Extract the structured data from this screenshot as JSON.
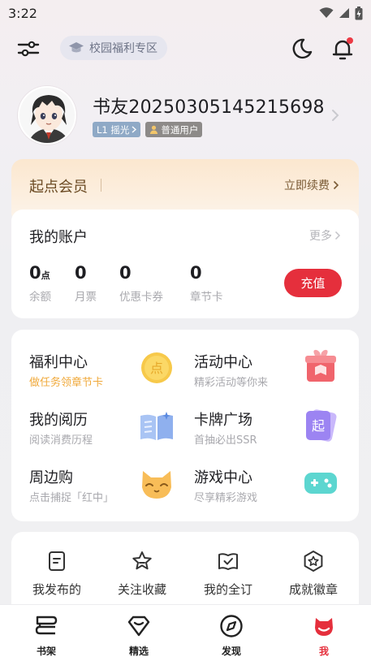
{
  "status_bar": {
    "time": "3:22"
  },
  "top_bar": {
    "campus_label": "校园福利专区"
  },
  "profile": {
    "username": "书友20250305145215698",
    "level_badge": "L1 摇光",
    "user_type_badge": "普通用户"
  },
  "vip": {
    "title": "起点会员",
    "renew_label": "立即续费"
  },
  "account": {
    "title": "我的账户",
    "more_label": "更多",
    "stats": [
      {
        "value": "0",
        "unit": "点",
        "label": "余额"
      },
      {
        "value": "0",
        "unit": "",
        "label": "月票"
      },
      {
        "value": "0",
        "unit": "",
        "label": "优惠卡券"
      },
      {
        "value": "0",
        "unit": "",
        "label": "章节卡"
      }
    ],
    "recharge_label": "充值"
  },
  "features": [
    {
      "title": "福利中心",
      "subtitle": "做任务领章节卡",
      "icon": "coin-icon"
    },
    {
      "title": "活动中心",
      "subtitle": "精彩活动等你来",
      "icon": "gift-box-icon"
    },
    {
      "title": "我的阅历",
      "subtitle": "阅读消费历程",
      "icon": "open-book-icon"
    },
    {
      "title": "卡牌广场",
      "subtitle": "首抽必出SSR",
      "icon": "card-icon"
    },
    {
      "title": "周边购",
      "subtitle": "点击捕捉「红中」",
      "icon": "cat-mascot-icon"
    },
    {
      "title": "游戏中心",
      "subtitle": "尽享精彩游戏",
      "icon": "gamepad-icon"
    }
  ],
  "actions": [
    {
      "label": "我发布的",
      "icon": "document-icon"
    },
    {
      "label": "关注收藏",
      "icon": "star-icon"
    },
    {
      "label": "我的全订",
      "icon": "subscribe-check-icon"
    },
    {
      "label": "成就徽章",
      "icon": "badge-icon"
    }
  ],
  "bottom_nav": [
    {
      "label": "书架",
      "icon": "bookshelf-icon"
    },
    {
      "label": "精选",
      "icon": "diamond-icon"
    },
    {
      "label": "发现",
      "icon": "compass-icon"
    },
    {
      "label": "我",
      "icon": "profile-mascot-icon",
      "active": true
    }
  ],
  "colors": {
    "accent": "#e52f3c",
    "vip_text": "#6b4a23",
    "muted": "#a9a9ae",
    "orange": "#f0a93b"
  }
}
